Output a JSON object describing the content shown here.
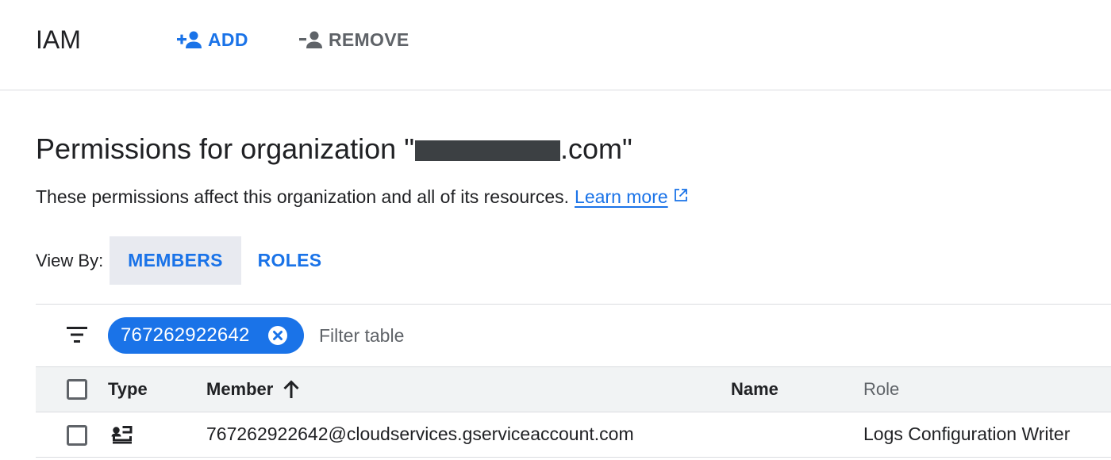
{
  "header": {
    "title": "IAM",
    "add_label": "ADD",
    "remove_label": "REMOVE"
  },
  "page": {
    "title_prefix": "Permissions for organization \"",
    "title_suffix": ".com\"",
    "description": "These permissions affect this organization and all of its resources.",
    "learn_more": "Learn more"
  },
  "view_by": {
    "label": "View By:",
    "tabs": [
      {
        "label": "MEMBERS",
        "selected": true
      },
      {
        "label": "ROLES",
        "selected": false
      }
    ]
  },
  "filter": {
    "chip_value": "767262922642",
    "placeholder": "Filter table"
  },
  "table": {
    "columns": [
      "Type",
      "Member",
      "Name",
      "Role"
    ],
    "sort_column": "Member",
    "sort_direction": "ascending",
    "rows": [
      {
        "type_icon": "service-account-icon",
        "member": "767262922642@cloudservices.gserviceaccount.com",
        "name": "",
        "role": "Logs Configuration Writer"
      }
    ]
  },
  "colors": {
    "accent": "#1a73e8",
    "text": "#202124",
    "muted": "#5f6368",
    "divider": "#dadce0",
    "selected_tab_bg": "#e8eaf0",
    "header_bg": "#f1f3f4"
  }
}
